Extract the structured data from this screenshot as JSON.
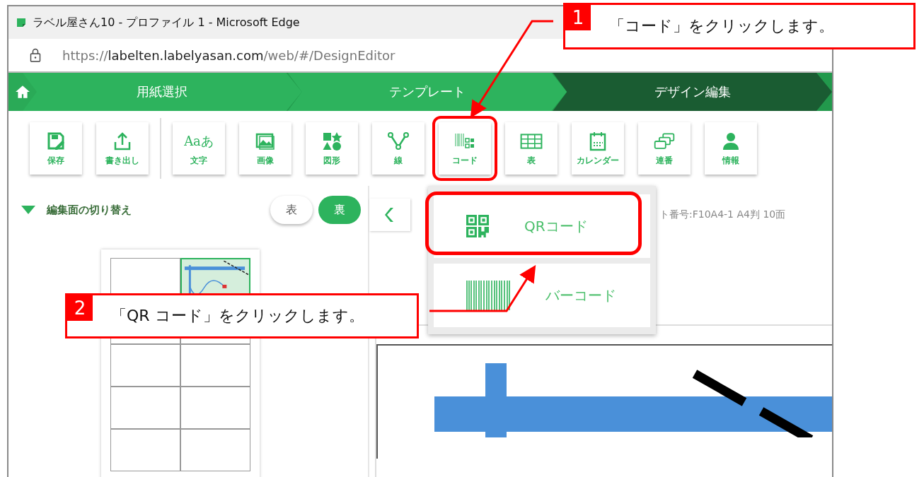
{
  "window": {
    "title": "ラベル屋さん10 - プロファイル 1 - Microsoft Edge"
  },
  "address_bar": {
    "url_parts": [
      {
        "text": "https://",
        "emphasis": false
      },
      {
        "text": "labelten.labelyasan.com",
        "emphasis": true
      },
      {
        "text": "/web/#/DesignEditor",
        "emphasis": false
      }
    ]
  },
  "steps": [
    {
      "label": "用紙選択",
      "selected": false
    },
    {
      "label": "テンプレート",
      "selected": false
    },
    {
      "label": "デザイン編集",
      "selected": true
    }
  ],
  "toolbar": {
    "file_tools": [
      {
        "label": "保存",
        "kind": "save",
        "highlighted": false
      },
      {
        "label": "書き出し",
        "kind": "export",
        "highlighted": false
      }
    ],
    "insert_tools": [
      {
        "label": "文字",
        "kind": "text",
        "glyph": "Aaあ",
        "highlighted": false
      },
      {
        "label": "画像",
        "kind": "image",
        "highlighted": false
      },
      {
        "label": "図形",
        "kind": "shapes",
        "highlighted": false
      },
      {
        "label": "線",
        "kind": "line",
        "highlighted": false
      },
      {
        "label": "コード",
        "kind": "code",
        "highlighted": true
      },
      {
        "label": "表",
        "kind": "table",
        "highlighted": false
      },
      {
        "label": "カレンダー",
        "kind": "calendar",
        "highlighted": false
      },
      {
        "label": "連番",
        "kind": "serial",
        "highlighted": false
      },
      {
        "label": "情報",
        "kind": "info",
        "highlighted": false
      }
    ]
  },
  "side_panel": {
    "title": "編集面の切り替え",
    "expanded": true,
    "sides": [
      {
        "label": "表",
        "selected": false
      },
      {
        "label": "裏",
        "selected": true
      }
    ]
  },
  "sheet_cells": [
    {
      "selected": false
    },
    {
      "selected": true
    },
    {
      "selected": false
    },
    {
      "selected": false
    },
    {
      "selected": false
    },
    {
      "selected": false
    },
    {
      "selected": false
    },
    {
      "selected": false
    },
    {
      "selected": false
    },
    {
      "selected": false
    }
  ],
  "info_text": "ト番号:F10A4-1 A4判 10面",
  "code_menu": {
    "items": [
      {
        "label": "QRコード",
        "kind": "qr",
        "highlighted": true
      },
      {
        "label": "バーコード",
        "kind": "barcode",
        "highlighted": false
      }
    ]
  },
  "callouts": [
    {
      "number": "1",
      "text": "「コード」をクリックします。"
    },
    {
      "number": "2",
      "text": "「QR コード」をクリックします。"
    }
  ]
}
